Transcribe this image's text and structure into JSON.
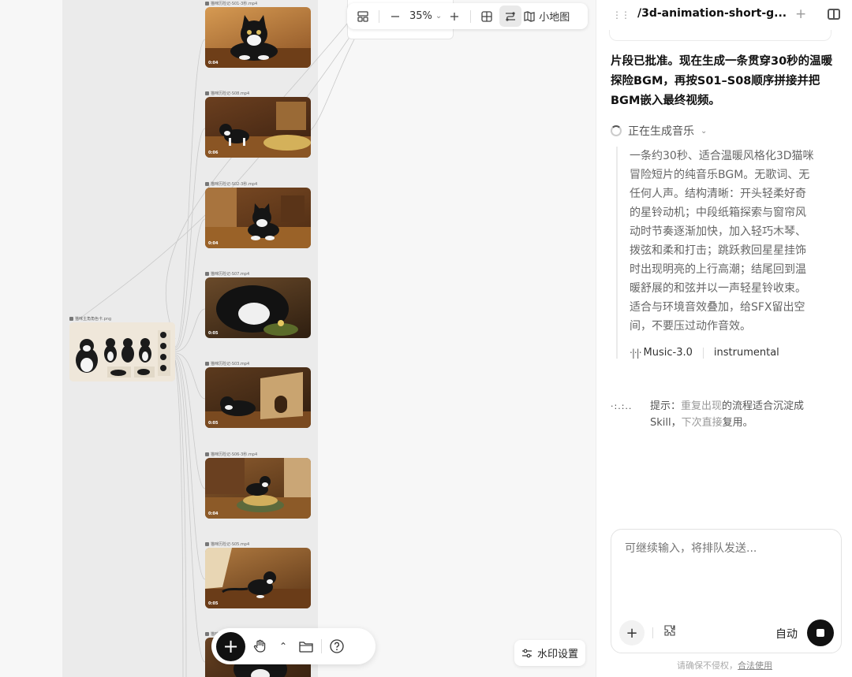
{
  "canvas": {
    "toolbar": {
      "zoom": "35%",
      "minimap_label": "小地图"
    },
    "reference_node": {
      "caption": "猫咪主角角色卡.png"
    },
    "video_nodes": [
      {
        "caption": "猫咪历险记-S01-3秒.mp4",
        "duration": "0:04"
      },
      {
        "caption": "猫咪历险记-S08.mp4",
        "duration": "0:06"
      },
      {
        "caption": "猫咪历险记-S02-3秒.mp4",
        "duration": "0:04"
      },
      {
        "caption": "猫咪历险记-S07.mp4",
        "duration": "0:05"
      },
      {
        "caption": "猫咪历险记-S03.mp4",
        "duration": "0:05"
      },
      {
        "caption": "猫咪历险记-S06-3秒.mp4",
        "duration": "0:04"
      },
      {
        "caption": "猫咪历险记-S05.mp4",
        "duration": "0:05"
      },
      {
        "caption": "猫咪历险记-S04.mp4",
        "duration": ""
      }
    ],
    "watermark_label": "水印设置"
  },
  "panel": {
    "title": "/3d-animation-short-g...",
    "assistant_message": "片段已批准。现在生成一条贯穿30秒的温暖探险BGM，再按S01–S08顺序拼接并把BGM嵌入最终视频。",
    "status": "正在生成音乐",
    "detail": "一条约30秒、适合温暖风格化3D猫咪冒险短片的纯音乐BGM。无歌词、无任何人声。结构清晰：开头轻柔好奇的星铃动机；中段纸箱探索与窗帘风动时节奏逐渐加快，加入轻巧木琴、拨弦和柔和打击；跳跃救回星星挂饰时出现明亮的上行高潮；结尾回到温暖舒展的和弦并以一声轻星铃收束。适合与环境音效叠加，给SFX留出空间，不要压过动作音效。",
    "model": "Music-3.0",
    "mode_tag": "instrumental",
    "hint_prefix": "提示：",
    "hint_muted_1": "重复出现",
    "hint_mid": "的流程适合沉淀成",
    "hint_line2_a": "Skill，",
    "hint_muted_2": "下次直接",
    "hint_line2_b": "复用。",
    "composer": {
      "placeholder": "可继续输入，将排队发送...",
      "mode": "自动"
    },
    "footnote_prefix": "请确保不侵权，",
    "footnote_link": "合法使用"
  }
}
